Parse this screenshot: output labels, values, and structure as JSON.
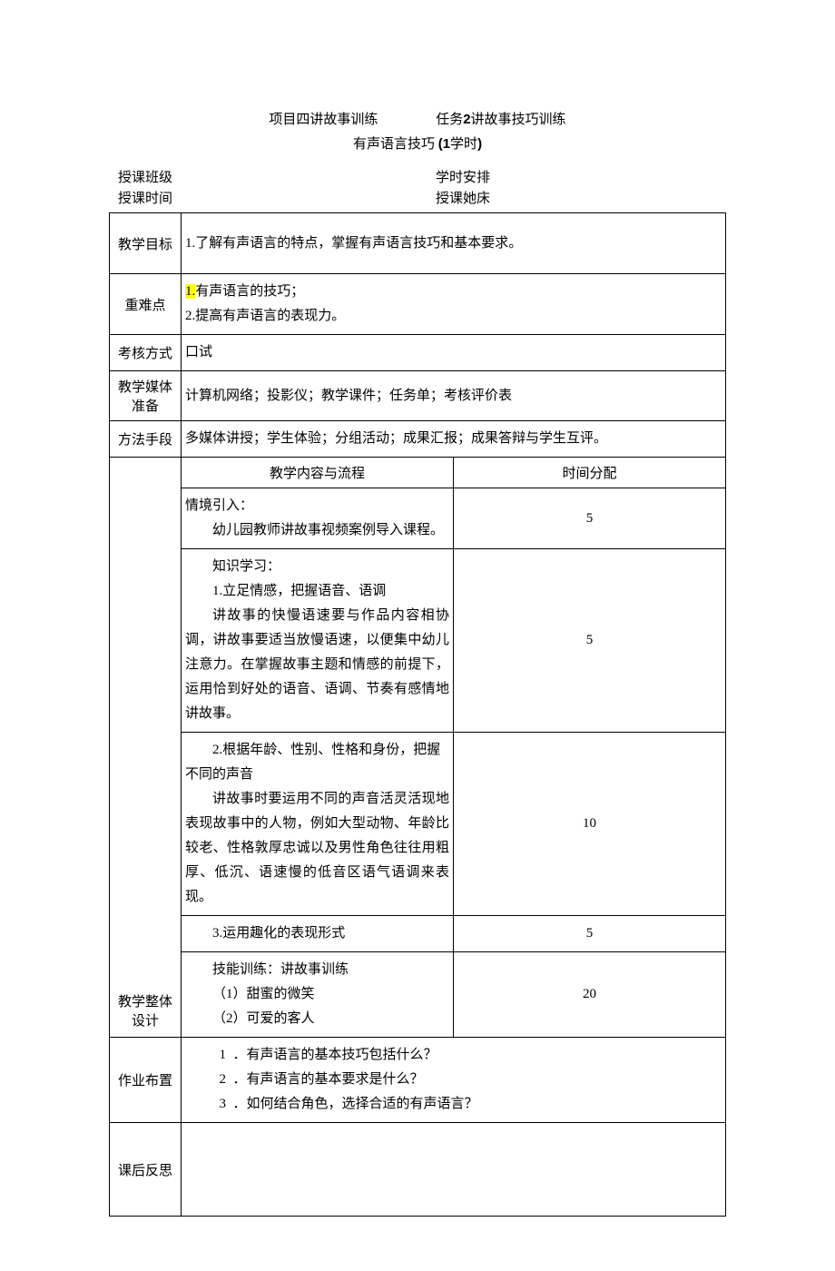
{
  "header": {
    "project": "项目四讲故事训练",
    "task_prefix": "任务",
    "task_num": "2",
    "task_suffix": "讲故事技巧训练",
    "subtitle_text": "有声语言技巧 ",
    "subtitle_paren_open": "(1",
    "subtitle_paren_mid": "学时",
    "subtitle_paren_close": ")"
  },
  "meta": {
    "class_label": "授课班级",
    "hours_label": "学时安排",
    "time_label": "授课时间",
    "place_label": "授课她床"
  },
  "rows": {
    "goal_label": "教学目标",
    "goal_text": "1.了解有声语言的特点，掌握有声语言技巧和基本要求。",
    "difficulty_label": "重难点",
    "difficulty_1_num": "1.",
    "difficulty_1_text": "有声语言的技巧；",
    "difficulty_2": "2.提高有声语言的表现力。",
    "assess_label": "考核方式",
    "assess_text": "口试",
    "media_label": "教学媒体准备",
    "media_text": "计算机网络；投影仪；教学课件；任务单；考核评价表",
    "method_label": "方法手段",
    "method_text": "多媒体讲授；学生体验；分组活动；成果汇报；成果答辩与学生互评。"
  },
  "design": {
    "label": "教学整体设计",
    "header_content": "教学内容与流程",
    "header_time": "时间分配",
    "r1": {
      "l1": "情境引入：",
      "l2": "幼儿园教师讲故事视频案例导入课程。",
      "time": "5"
    },
    "r2": {
      "l1": "知识学习：",
      "l2": "1.立足情感，把握语音、语调",
      "l3": "讲故事的快慢语速要与作品内容相协调，讲故事要适当放慢语速，以便集中幼儿注意力。在掌握故事主题和情感的前提下，运用恰到好处的语音、语调、节奏有感情地讲故事。",
      "time": "5"
    },
    "r3": {
      "l1": "2.根据年龄、性别、性格和身份，把握不同的声音",
      "l2": "讲故事时要运用不同的声音活灵活现地表现故事中的人物，例如大型动物、年龄比较老、性格敦厚忠诚以及男性角色往往用粗厚、低沉、语速慢的低音区语气语调来表现。",
      "time": "10"
    },
    "r4": {
      "l1": "3.运用趣化的表现形式",
      "time": "5"
    },
    "r5": {
      "l1": "技能训练：讲故事训练",
      "l2": "（1）甜蜜的微笑",
      "l3": "（2）可爱的客人",
      "time": "20"
    }
  },
  "homework": {
    "label": "作业布置",
    "n1": "1",
    "q1": "．有声语言的基本技巧包括什么？",
    "n2": "2",
    "q2": "．有声语言的基本要求是什么？",
    "n3": "3",
    "q3": "．如何结合角色，选择合适的有声语言？"
  },
  "reflect": {
    "label": "课后反思"
  }
}
